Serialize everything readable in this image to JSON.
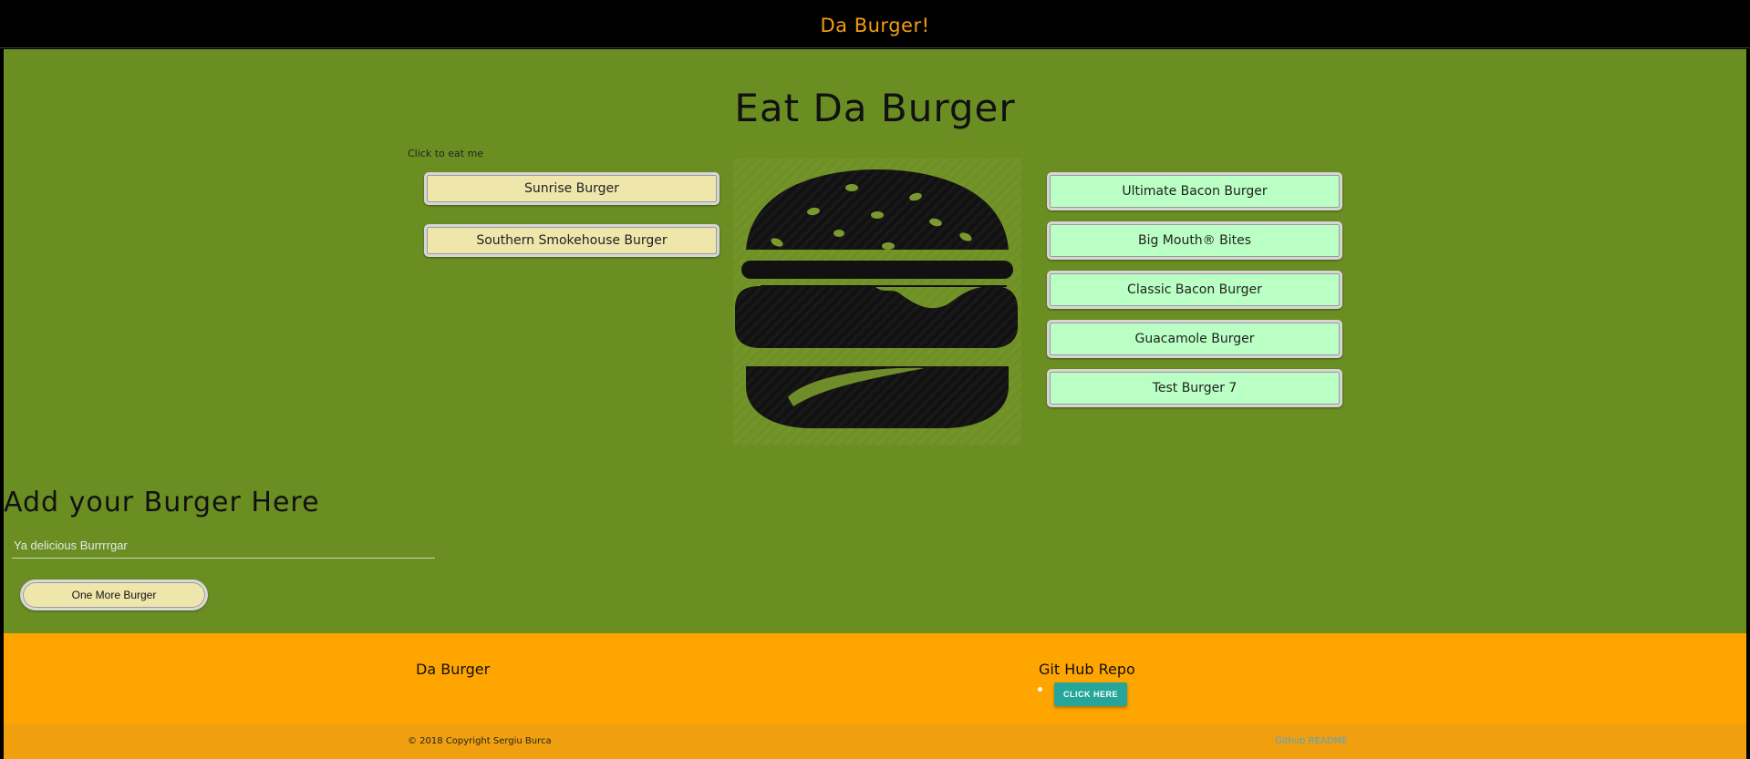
{
  "navbar": {
    "brand": "Da Burger!"
  },
  "main": {
    "title": "Eat Da Burger",
    "click_hint": "Click to eat me",
    "uneaten": [
      "Sunrise Burger",
      "Southern Smokehouse Burger"
    ],
    "eaten": [
      "Ultimate Bacon Burger",
      "Big Mouth® Bites",
      "Classic Bacon Burger",
      "Guacamole Burger",
      "Test Burger 7"
    ],
    "burger_image_icon": "burger-icon"
  },
  "add_form": {
    "title": "Add your Burger Here",
    "placeholder": "Ya delicious Burrrrgar",
    "submit_label": "One More Burger"
  },
  "footer": {
    "brand": "Da Burger",
    "repo_title": "Git Hub Repo",
    "repo_button": "CLICK HERE",
    "copyright": "© 2018 Copyright Sergiu Burca",
    "readme_link": "Github README"
  },
  "colors": {
    "navbar_bg": "#000000",
    "brand": "#f39c12",
    "main_bg": "#6b8e23",
    "uneaten_btn": "#efe6ac",
    "eaten_btn": "#baffc4",
    "footer_bg": "#ffa500",
    "repo_btn": "#26a69a"
  }
}
